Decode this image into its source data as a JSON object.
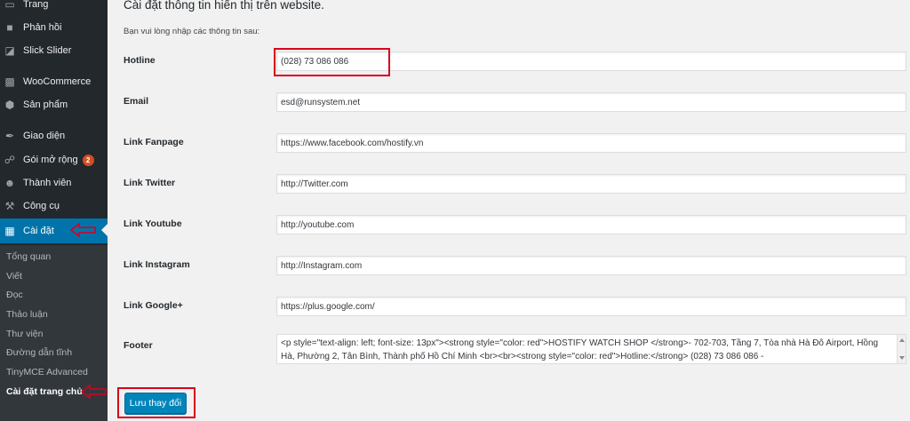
{
  "sidebar": {
    "items": [
      {
        "label": "Trang",
        "icon": "pages-icon"
      },
      {
        "label": "Phản hồi",
        "icon": "comments-icon"
      },
      {
        "label": "Slick Slider",
        "icon": "slider-icon"
      },
      {
        "label": "WooCommerce",
        "icon": "woocommerce-icon"
      },
      {
        "label": "Sản phẩm",
        "icon": "products-icon"
      },
      {
        "label": "Giao diện",
        "icon": "appearance-icon"
      },
      {
        "label": "Gói mở rộng",
        "icon": "plugins-icon",
        "badge": "2"
      },
      {
        "label": "Thành viên",
        "icon": "users-icon"
      },
      {
        "label": "Công cụ",
        "icon": "tools-icon"
      },
      {
        "label": "Cài đặt",
        "icon": "settings-icon",
        "active": true
      }
    ],
    "submenu": [
      "Tổng quan",
      "Viết",
      "Đọc",
      "Thảo luận",
      "Thư viện",
      "Đường dẫn tĩnh",
      "TinyMCE Advanced",
      "Cài đặt trang chủ"
    ],
    "active_color": "#0073aa",
    "background_color": "#23282d"
  },
  "main": {
    "title": "Cài đặt thông tin hiển thị trên website.",
    "intro": "Bạn vui lòng nhập các thông tin sau:",
    "fields": [
      {
        "label": "Hotline",
        "value": "(028) 73 086 086"
      },
      {
        "label": "Email",
        "value": "esd@runsystem.net"
      },
      {
        "label": "Link Fanpage",
        "value": "https://www.facebook.com/hostify.vn"
      },
      {
        "label": "Link Twitter",
        "value": "http://Twitter.com"
      },
      {
        "label": "Link Youtube",
        "value": "http://youtube.com"
      },
      {
        "label": "Link Instagram",
        "value": "http://Instagram.com"
      },
      {
        "label": "Link Google+",
        "value": "https://plus.google.com/"
      }
    ],
    "footer": {
      "label": "Footer",
      "value": "<p style=\"text-align: left; font-size: 13px\"><strong style=\"color: red\">HOSTIFY WATCH SHOP </strong>- 702-703, Tầng 7, Tòa nhà Hà Đô Airport, Hồng Hà, Phường 2, Tân Bình, Thành phố Hồ Chí Minh <br><br><strong style=\"color: red\">Hotline:</strong> (028) 73 086 086 -"
    },
    "save_label": "Lưu thay đổi",
    "button_color": "#0085ba",
    "annotation_color": "#d9001b"
  }
}
